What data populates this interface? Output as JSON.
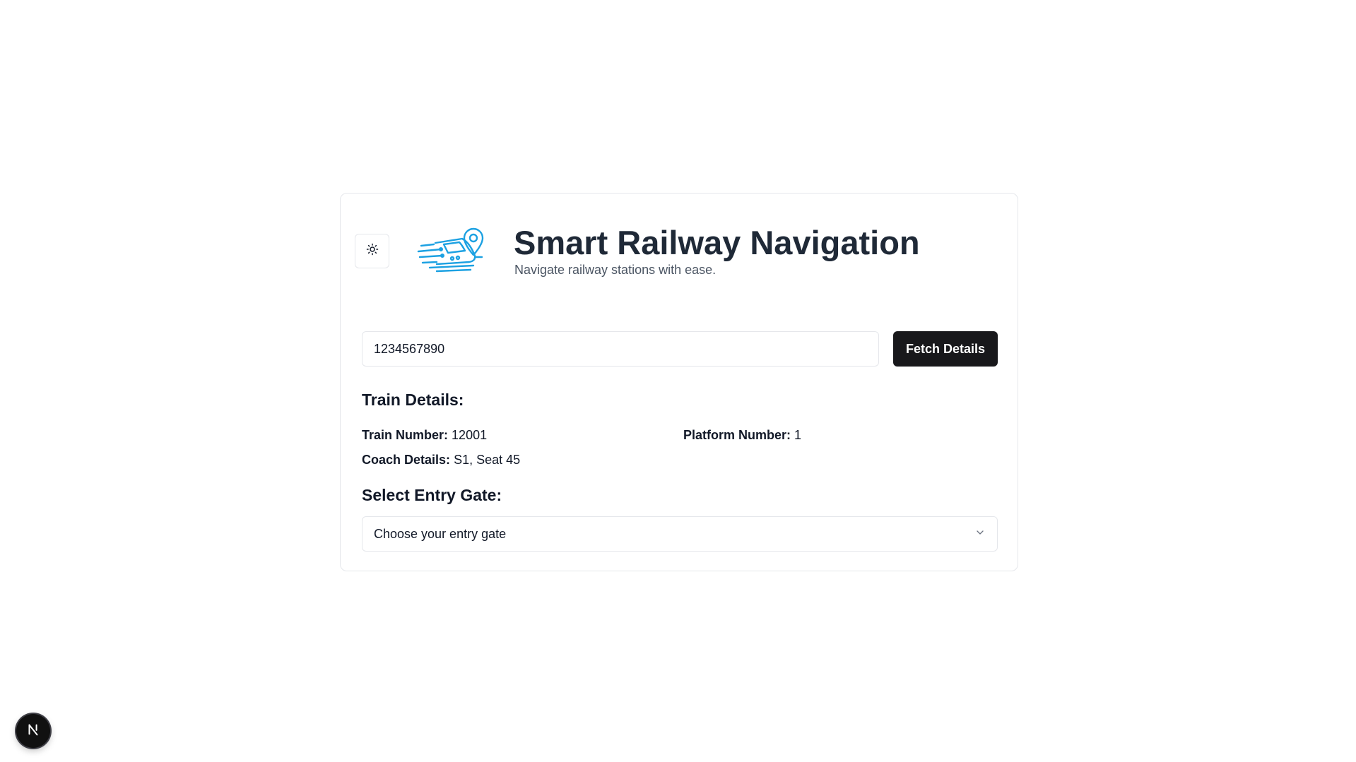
{
  "header": {
    "title": "Smart Railway Navigation",
    "subtitle": "Navigate railway stations with ease.",
    "theme_toggle_icon": "sun-icon",
    "logo_icon": "train-location-icon",
    "logo_color": "#1ca1e2"
  },
  "search": {
    "value": "1234567890",
    "button_label": "Fetch Details"
  },
  "train_details": {
    "heading": "Train Details:",
    "train_number_label": "Train Number:",
    "train_number_value": "12001",
    "platform_number_label": "Platform Number:",
    "platform_number_value": "1",
    "coach_details_label": "Coach Details:",
    "coach_details_value": "S1, Seat 45"
  },
  "entry_gate": {
    "heading": "Select Entry Gate:",
    "selected": "Choose your entry gate",
    "icon": "chevron-down-icon"
  },
  "dev_badge": {
    "letter": "N"
  },
  "colors": {
    "primary_button": "#18181b",
    "border": "#e5e7eb",
    "title": "#1f2937",
    "accent": "#1ca1e2"
  }
}
